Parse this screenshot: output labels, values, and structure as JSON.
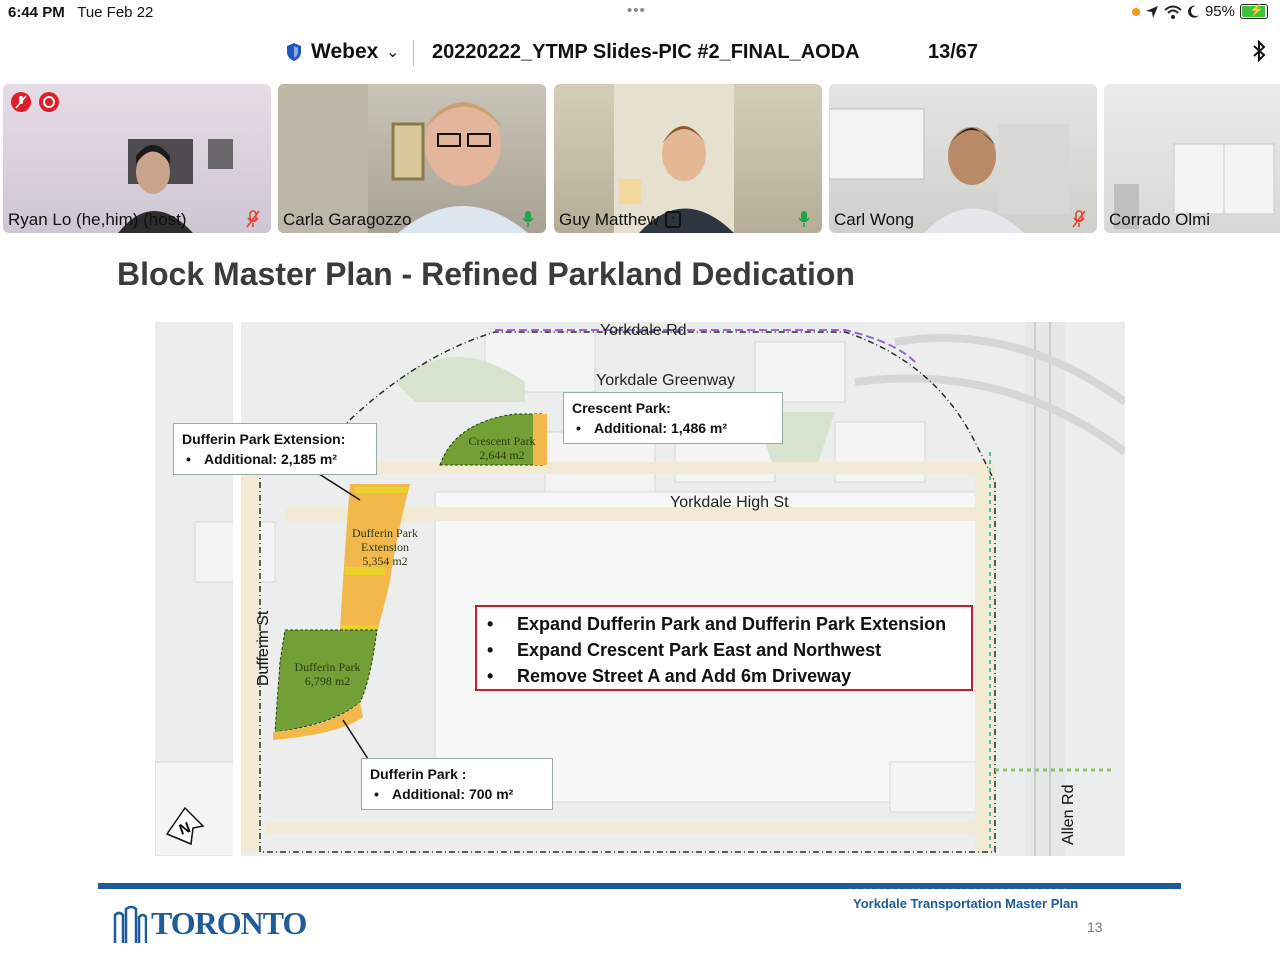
{
  "status_bar": {
    "time": "6:44 PM",
    "date": "Tue Feb 22",
    "dots": "•••",
    "battery_percent": "95%",
    "icons": [
      "location-icon",
      "wifi-icon",
      "moon-icon",
      "battery-charging-icon"
    ]
  },
  "title_bar": {
    "app_name": "Webex",
    "document_title": "20220222_YTMP Slides-PIC #2_FINAL_AODA",
    "slide_counter": "13/67",
    "icons": [
      "shield-icon",
      "chevron-down-icon",
      "bluetooth-icon"
    ]
  },
  "participants": [
    {
      "name": "Ryan Lo (he,him) (host)",
      "mic": "muted",
      "share": false
    },
    {
      "name": "Carla Garagozzo",
      "mic": "on",
      "share": false
    },
    {
      "name": "Guy Matthew",
      "mic": "on",
      "share": true
    },
    {
      "name": "Carl Wong",
      "mic": "muted",
      "share": false
    },
    {
      "name": "Corrado Olmi",
      "mic": "none",
      "share": false
    }
  ],
  "colors": {
    "mic_on": "#1fa34a",
    "mic_muted": "#e5442f",
    "recording": "#e21d2b",
    "toronto_blue": "#1d5b9b",
    "park_green": "#6e9a2c",
    "park_extension_orange": "#f2b84b",
    "highlight_box": "#c8202a"
  },
  "slide": {
    "title": "Block Master Plan - Refined Parkland Dedication",
    "roads": {
      "yorkdale_rd": "Yorkdale Rd",
      "yorkdale_greenway": "Yorkdale Greenway",
      "yorkdale_high_st": "Yorkdale High St",
      "dufferin_st": "Dufferin St",
      "allen_rd": "Allen Rd"
    },
    "parks": {
      "crescent_park": {
        "line1": "Crescent Park",
        "line2": "2,644 m2"
      },
      "dufferin_park_extension": {
        "line1": "Dufferin Park",
        "line2": "Extension",
        "line3": "5,354 m2"
      },
      "dufferin_park": {
        "line1": "Dufferin Park",
        "line2": "6,798 m2"
      }
    },
    "callouts": {
      "crescent": {
        "title": "Crescent Park:",
        "item": "Additional: 1,486 m²"
      },
      "dufferin_ext": {
        "title": "Dufferin Park Extension:",
        "item": "Additional: 2,185 m²"
      },
      "dufferin": {
        "title": "Dufferin Park :",
        "item": "Additional: 700 m²"
      }
    },
    "highlights": [
      "Expand Dufferin Park and Dufferin Park Extension",
      "Expand Crescent Park East and Northwest",
      "Remove Street A and Add 6m Driveway"
    ],
    "north_arrow": "N",
    "footer_logo": "TORONTO",
    "footer_caption": "Yorkdale Transportation Master Plan",
    "page_number": "13"
  }
}
